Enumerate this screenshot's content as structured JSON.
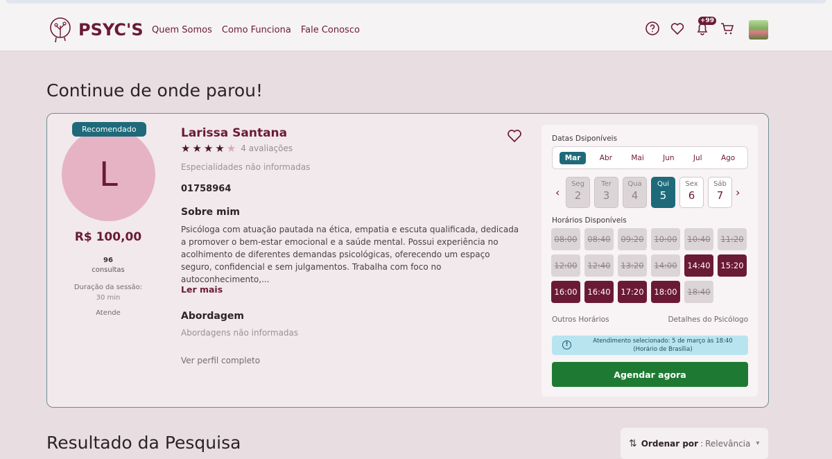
{
  "header": {
    "brand": "PSYC'S",
    "nav": [
      "Quem Somos",
      "Como Funciona",
      "Fale Conosco"
    ],
    "notif_badge": "+99",
    "icons": [
      "help-icon",
      "heart-icon",
      "bell-icon",
      "cart-icon"
    ]
  },
  "page_title": "Continue de onde parou!",
  "card": {
    "recommended": "Recomendado",
    "avatar_initial": "L",
    "price": "R$ 100,00",
    "consult_count": "96",
    "consult_label": "consultas",
    "duration_label": "Duração da sessão:",
    "duration_value": "30 min",
    "atende": "Atende",
    "name": "Larissa Santana",
    "rating": 4,
    "rating_max": 5,
    "reviews": "4 avaliações",
    "specialties": "Especialidades não informadas",
    "code": "01758964",
    "about_title": "Sobre mim",
    "about_text": "Psicóloga com atuação pautada na ética, empatia e escuta qualificada, dedicada a promover o bem-estar emocional e a saúde mental. Possui experiência no acolhimento de diferentes demandas psicológicas, oferecendo um espaço seguro, confidencial e sem julgamentos. Trabalha com foco no autoconhecimento,...",
    "read_more": "Ler mais",
    "approach_title": "Abordagem",
    "approach_text": "Abordagens não informadas",
    "profile_link": "Ver perfil completo"
  },
  "schedule": {
    "dates_title": "Datas Dsiponíveis",
    "months": [
      "Mar",
      "Abr",
      "Mai",
      "Jun",
      "Jul",
      "Ago"
    ],
    "selected_month": "Mar",
    "days": [
      {
        "name": "Seg",
        "num": "2",
        "state": "disabled"
      },
      {
        "name": "Ter",
        "num": "3",
        "state": "disabled"
      },
      {
        "name": "Qua",
        "num": "4",
        "state": "disabled"
      },
      {
        "name": "Qui",
        "num": "5",
        "state": "selected"
      },
      {
        "name": "Sex",
        "num": "6",
        "state": "available"
      },
      {
        "name": "Sáb",
        "num": "7",
        "state": "available"
      }
    ],
    "times_title": "Horários Disponíveis",
    "slots": [
      {
        "time": "08:00",
        "available": false
      },
      {
        "time": "08:40",
        "available": false
      },
      {
        "time": "09:20",
        "available": false
      },
      {
        "time": "10:00",
        "available": false
      },
      {
        "time": "10:40",
        "available": false
      },
      {
        "time": "11:20",
        "available": false
      },
      {
        "time": "12:00",
        "available": false
      },
      {
        "time": "12:40",
        "available": false
      },
      {
        "time": "13:20",
        "available": false
      },
      {
        "time": "14:00",
        "available": false
      },
      {
        "time": "14:40",
        "available": true
      },
      {
        "time": "15:20",
        "available": true
      },
      {
        "time": "16:00",
        "available": true
      },
      {
        "time": "16:40",
        "available": true
      },
      {
        "time": "17:20",
        "available": true
      },
      {
        "time": "18:00",
        "available": true
      },
      {
        "time": "18:40",
        "available": false
      }
    ],
    "other_times": "Outros Horários",
    "details": "Detalhes do Psicólogo",
    "selected_info_1": "Atendimento selecionado: 5 de março às 18:40",
    "selected_info_2": "(Horário de Brasília)",
    "book_button": "Agendar agora"
  },
  "results_title": "Resultado da Pesquisa",
  "sort": {
    "label": "Ordenar por",
    "value": "Relevância"
  },
  "colors": {
    "brand": "#6b1a36",
    "accent": "#1e6a7a",
    "book": "#1e7a32",
    "background": "#e8dde0"
  }
}
